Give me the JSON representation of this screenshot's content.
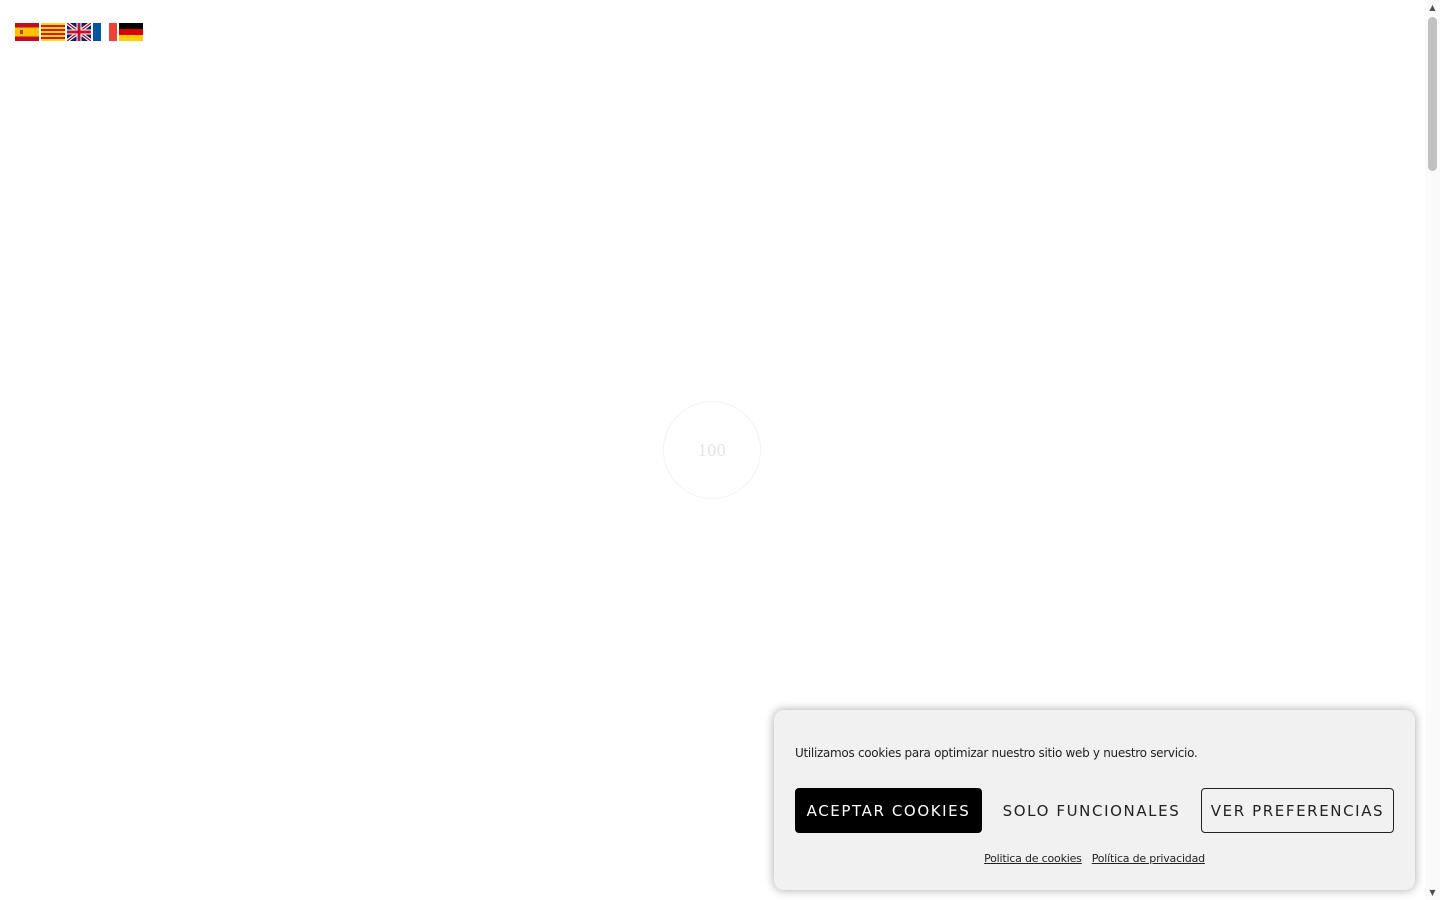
{
  "languages": [
    {
      "code": "es",
      "label": "Español"
    },
    {
      "code": "ca",
      "label": "Català"
    },
    {
      "code": "en",
      "label": "English"
    },
    {
      "code": "fr",
      "label": "Français"
    },
    {
      "code": "de",
      "label": "Deutsch"
    }
  ],
  "loader": {
    "text": "100"
  },
  "cookie_banner": {
    "message": "Utilizamos cookies para optimizar nuestro sitio web y nuestro servicio.",
    "accept_label": "Aceptar cookies",
    "functional_label": "Solo funcionales",
    "preferences_label": "Ver preferencias",
    "cookie_policy_link": "Politica de cookies",
    "privacy_policy_link": "Política de privacidad"
  },
  "colors": {
    "accept_button_bg": "#000000",
    "banner_bg": "#f1f1f1",
    "page_bg": "#ffffff"
  }
}
